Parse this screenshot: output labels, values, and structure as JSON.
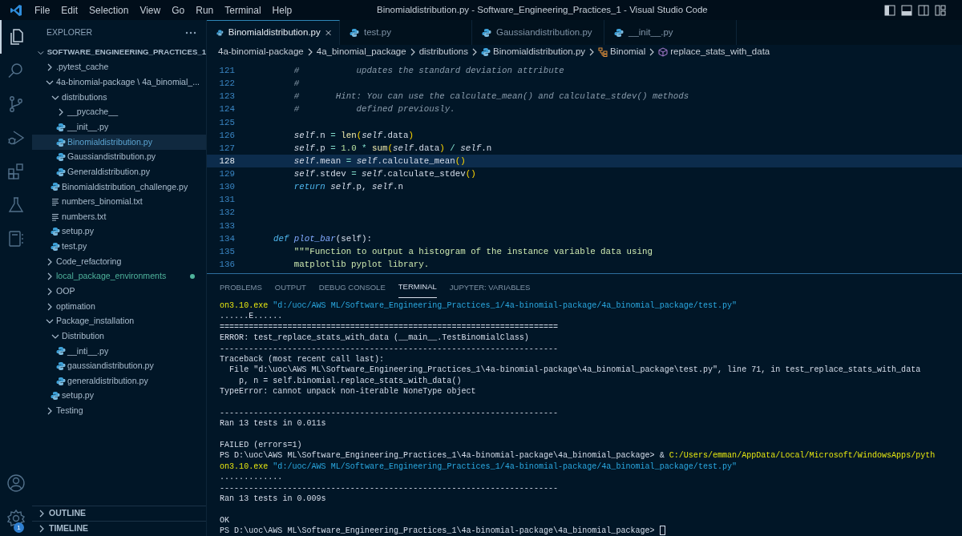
{
  "window": {
    "title": "Binomialdistribution.py - Software_Engineering_Practices_1 - Visual Studio Code"
  },
  "menu": [
    "File",
    "Edit",
    "Selection",
    "View",
    "Go",
    "Run",
    "Terminal",
    "Help"
  ],
  "activity_bar": {
    "top": [
      {
        "kind": "explorer",
        "selected": true
      },
      {
        "kind": "search",
        "selected": false
      },
      {
        "kind": "source-control",
        "selected": false
      },
      {
        "kind": "run-debug",
        "selected": false
      },
      {
        "kind": "extensions",
        "selected": false
      },
      {
        "kind": "testing",
        "selected": false
      },
      {
        "kind": "notebook",
        "selected": false
      }
    ],
    "bottom": [
      {
        "kind": "account"
      },
      {
        "kind": "settings",
        "badge": "1"
      }
    ]
  },
  "sidebar": {
    "title": "EXPLORER",
    "root": {
      "label": "SOFTWARE_ENGINEERING_PRACTICES_1",
      "expanded": true,
      "children": [
        {
          "label": ".pytest_cache",
          "kind": "folder",
          "expanded": false,
          "selected": false
        },
        {
          "label": "4a-binomial-package \\ 4a_binomial_...",
          "kind": "folder",
          "expanded": true,
          "selected": false,
          "children": [
            {
              "label": "distributions",
              "kind": "folder",
              "expanded": true,
              "selected": false,
              "children": [
                {
                  "label": "__pycache__",
                  "kind": "folder",
                  "expanded": false,
                  "selected": false
                },
                {
                  "label": "__init__.py",
                  "kind": "python",
                  "selected": false
                },
                {
                  "label": "Binomialdistribution.py",
                  "kind": "python",
                  "selected": true
                },
                {
                  "label": "Gaussiandistribution.py",
                  "kind": "python",
                  "selected": false
                },
                {
                  "label": "Generaldistribution.py",
                  "kind": "python",
                  "selected": false
                }
              ]
            },
            {
              "label": "Binomialdistribution_challenge.py",
              "kind": "python",
              "selected": false
            },
            {
              "label": "numbers_binomial.txt",
              "kind": "text",
              "selected": false
            },
            {
              "label": "numbers.txt",
              "kind": "text",
              "selected": false
            },
            {
              "label": "setup.py",
              "kind": "python",
              "selected": false
            },
            {
              "label": "test.py",
              "kind": "python",
              "selected": false
            }
          ]
        },
        {
          "label": "Code_refactoring",
          "kind": "folder",
          "expanded": false,
          "selected": false
        },
        {
          "label": "local_package_environments",
          "kind": "folder",
          "expanded": false,
          "selected": false,
          "color": "#4fb39c"
        },
        {
          "label": "OOP",
          "kind": "folder",
          "expanded": false,
          "selected": false
        },
        {
          "label": "optimation",
          "kind": "folder",
          "expanded": false,
          "selected": false
        },
        {
          "label": "Package_installation",
          "kind": "folder",
          "expanded": true,
          "selected": false,
          "children": [
            {
              "label": "Distribution",
              "kind": "folder",
              "expanded": true,
              "selected": false,
              "children": [
                {
                  "label": "__inti__.py",
                  "kind": "python",
                  "selected": false
                },
                {
                  "label": "gaussiandistribution.py",
                  "kind": "python",
                  "selected": false
                },
                {
                  "label": "generaldistribution.py",
                  "kind": "python",
                  "selected": false
                }
              ]
            },
            {
              "label": "setup.py",
              "kind": "python",
              "selected": false
            }
          ]
        },
        {
          "label": "Testing",
          "kind": "folder",
          "expanded": false,
          "selected": false
        }
      ]
    },
    "sections": [
      {
        "label": "OUTLINE",
        "expanded": false
      },
      {
        "label": "TIMELINE",
        "expanded": false
      }
    ]
  },
  "tabs": [
    {
      "label": "Binomialdistribution.py",
      "selected": true
    },
    {
      "label": "test.py",
      "selected": false
    },
    {
      "label": "Gaussiandistribution.py",
      "selected": false
    },
    {
      "label": "__init__.py",
      "selected": false
    }
  ],
  "breadcrumb": [
    {
      "label": "4a-binomial-package",
      "kind": "folder"
    },
    {
      "label": "4a_binomial_package",
      "kind": "folder"
    },
    {
      "label": "distributions",
      "kind": "folder"
    },
    {
      "label": "Binomialdistribution.py",
      "kind": "file"
    },
    {
      "label": "Binomial",
      "kind": "class"
    },
    {
      "label": "replace_stats_with_data",
      "kind": "method"
    }
  ],
  "editor": {
    "lines": [
      {
        "number": "121",
        "current": false,
        "tokens": [
          {
            "kind": "comment",
            "text": "        #           updates the standard deviation attribute"
          }
        ]
      },
      {
        "number": "122",
        "current": false,
        "tokens": [
          {
            "kind": "comment",
            "text": "        #"
          }
        ]
      },
      {
        "number": "123",
        "current": false,
        "tokens": [
          {
            "kind": "comment",
            "text": "        #       Hint: You can use the calculate_mean() and calculate_stdev() methods"
          }
        ]
      },
      {
        "number": "124",
        "current": false,
        "tokens": [
          {
            "kind": "comment",
            "text": "        #           defined previously."
          }
        ]
      },
      {
        "number": "125",
        "current": false
      },
      {
        "number": "126",
        "current": false,
        "tokens": [
          {
            "kind": "self",
            "text": "        self"
          },
          {
            "kind": "plain",
            "text": ".n "
          },
          {
            "kind": "operator",
            "text": "= "
          },
          {
            "kind": "builtin",
            "text": "len"
          },
          {
            "kind": "bracket",
            "text": "("
          },
          {
            "kind": "self",
            "text": "self"
          },
          {
            "kind": "plain",
            "text": ".data"
          },
          {
            "kind": "bracket",
            "text": ")"
          }
        ]
      },
      {
        "number": "127",
        "current": false,
        "tokens": [
          {
            "kind": "self",
            "text": "        self"
          },
          {
            "kind": "plain",
            "text": ".p "
          },
          {
            "kind": "operator",
            "text": "= "
          },
          {
            "kind": "number",
            "text": "1.0 "
          },
          {
            "kind": "operator",
            "text": "* "
          },
          {
            "kind": "builtin",
            "text": "sum"
          },
          {
            "kind": "bracket",
            "text": "("
          },
          {
            "kind": "self",
            "text": "self"
          },
          {
            "kind": "plain",
            "text": ".data"
          },
          {
            "kind": "bracket",
            "text": ")"
          },
          {
            "kind": "operator",
            "text": " / "
          },
          {
            "kind": "self",
            "text": "self"
          },
          {
            "kind": "plain",
            "text": ".n"
          }
        ]
      },
      {
        "number": "128",
        "current": true,
        "tokens": [
          {
            "kind": "self",
            "text": "        self"
          },
          {
            "kind": "plain",
            "text": ".mean "
          },
          {
            "kind": "operator",
            "text": "= "
          },
          {
            "kind": "self",
            "text": "self"
          },
          {
            "kind": "plain",
            "text": ".calculate_mean"
          },
          {
            "kind": "bracket",
            "text": "()"
          }
        ]
      },
      {
        "number": "129",
        "current": false,
        "tokens": [
          {
            "kind": "self",
            "text": "        self"
          },
          {
            "kind": "plain",
            "text": ".stdev "
          },
          {
            "kind": "operator",
            "text": "= "
          },
          {
            "kind": "self",
            "text": "self"
          },
          {
            "kind": "plain",
            "text": ".calculate_stdev"
          },
          {
            "kind": "bracket",
            "text": "()"
          }
        ]
      },
      {
        "number": "130",
        "current": false,
        "tokens": [
          {
            "kind": "keyword",
            "text": "        return "
          },
          {
            "kind": "self",
            "text": "self"
          },
          {
            "kind": "plain",
            "text": ".p, "
          },
          {
            "kind": "self",
            "text": "self"
          },
          {
            "kind": "plain",
            "text": ".n"
          }
        ]
      },
      {
        "number": "131",
        "current": false
      },
      {
        "number": "132",
        "current": false
      },
      {
        "number": "133",
        "current": false
      },
      {
        "number": "134",
        "current": false,
        "tokens": [
          {
            "kind": "keyword",
            "text": "    def "
          },
          {
            "kind": "function",
            "text": "plot_bar"
          },
          {
            "kind": "plain",
            "text": "(self):"
          }
        ]
      },
      {
        "number": "135",
        "current": false,
        "tokens": [
          {
            "kind": "string",
            "text": "        \"\"\"Function to output a histogram of the instance variable data using"
          }
        ]
      },
      {
        "number": "136",
        "current": false,
        "tokens": [
          {
            "kind": "string",
            "text": "        matplotlib pyplot library."
          }
        ]
      }
    ]
  },
  "panel": {
    "tabs": [
      {
        "label": "PROBLEMS",
        "selected": false
      },
      {
        "label": "OUTPUT",
        "selected": false
      },
      {
        "label": "DEBUG CONSOLE",
        "selected": false
      },
      {
        "label": "TERMINAL",
        "selected": true
      },
      {
        "label": "JUPYTER: VARIABLES",
        "selected": false
      }
    ],
    "terminal": [
      {
        "lines": [
          {
            "segments": [
              {
                "kind": "command",
                "text": "on3.10.exe "
              },
              {
                "kind": "string",
                "text": "\"d:/uoc/AWS ML/Software_Engineering_Practices_1/4a-binomial-package/4a_binomial_package/test.py\""
              }
            ]
          },
          {
            "segments": [
              {
                "kind": "plain",
                "text": "......E......"
              }
            ]
          },
          {
            "segments": [
              {
                "kind": "plain",
                "text": "======================================================================"
              }
            ]
          },
          {
            "segments": [
              {
                "kind": "plain",
                "text": "ERROR: test_replace_stats_with_data (__main__.TestBinomialClass)"
              }
            ]
          },
          {
            "segments": [
              {
                "kind": "plain",
                "text": "----------------------------------------------------------------------"
              }
            ]
          },
          {
            "segments": [
              {
                "kind": "plain",
                "text": "Traceback (most recent call last):"
              }
            ]
          },
          {
            "segments": [
              {
                "kind": "plain",
                "text": "  File \"d:\\uoc\\AWS ML\\Software_Engineering_Practices_1\\4a-binomial-package\\4a_binomial_package\\test.py\", line 71, in test_replace_stats_with_data"
              }
            ]
          },
          {
            "segments": [
              {
                "kind": "plain",
                "text": "    p, n = self.binomial.replace_stats_with_data()"
              }
            ]
          },
          {
            "segments": [
              {
                "kind": "plain",
                "text": "TypeError: cannot unpack non-iterable NoneType object"
              }
            ]
          }
        ]
      },
      {
        "lines": [
          {
            "segments": [
              {
                "kind": "plain",
                "text": "----------------------------------------------------------------------"
              }
            ]
          },
          {
            "segments": [
              {
                "kind": "plain",
                "text": "Ran 13 tests in 0.011s"
              }
            ]
          }
        ]
      },
      {
        "lines": [
          {
            "segments": [
              {
                "kind": "plain",
                "text": "FAILED (errors=1)"
              }
            ]
          },
          {
            "segments": [
              {
                "kind": "plain",
                "text": "PS D:\\uoc\\AWS ML\\Software_Engineering_Practices_1\\4a-binomial-package\\4a_binomial_package> & "
              },
              {
                "kind": "command",
                "text": "C:/Users/emman/AppData/Local/Microsoft/WindowsApps/pyth"
              }
            ]
          },
          {
            "segments": [
              {
                "kind": "command",
                "text": "on3.10.exe "
              },
              {
                "kind": "string",
                "text": "\"d:/uoc/AWS ML/Software_Engineering_Practices_1/4a-binomial-package/4a_binomial_package/test.py\""
              }
            ]
          },
          {
            "segments": [
              {
                "kind": "plain",
                "text": "............."
              }
            ]
          },
          {
            "segments": [
              {
                "kind": "plain",
                "text": "----------------------------------------------------------------------"
              }
            ]
          },
          {
            "segments": [
              {
                "kind": "plain",
                "text": "Ran 13 tests in 0.009s"
              }
            ]
          }
        ]
      },
      {
        "lines": [
          {
            "segments": [
              {
                "kind": "plain",
                "text": "OK"
              }
            ]
          },
          {
            "cursor": true,
            "segments": [
              {
                "kind": "plain",
                "text": "PS D:\\uoc\\AWS ML\\Software_Engineering_Practices_1\\4a-binomial-package\\4a_binomial_package> "
              }
            ]
          }
        ]
      }
    ]
  }
}
